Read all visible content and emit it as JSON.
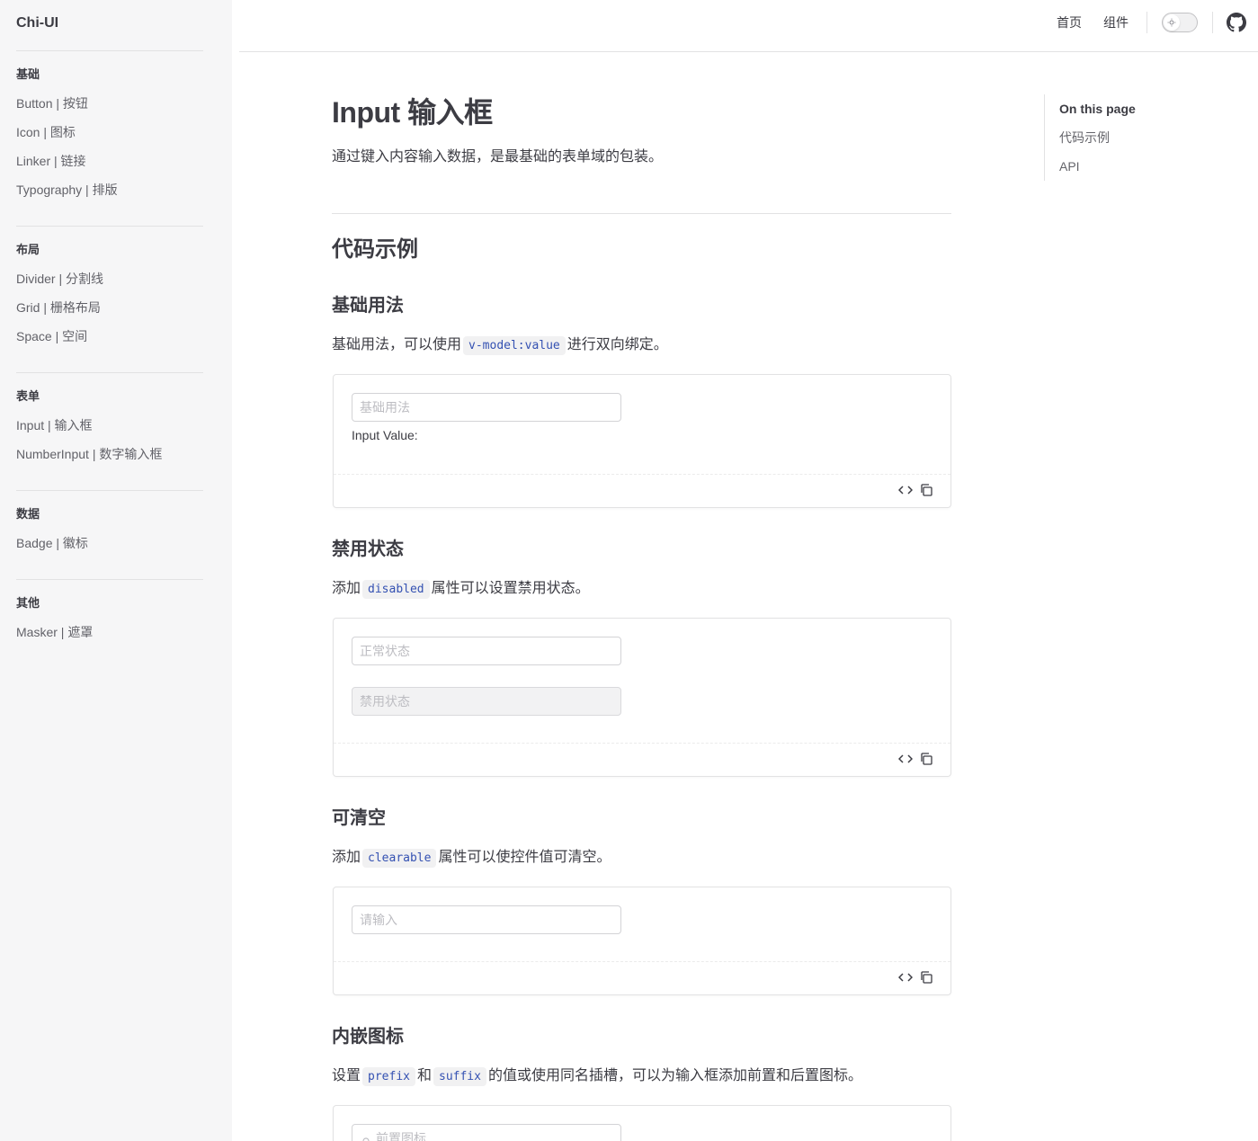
{
  "brand": "Chi-UI",
  "sidebar": {
    "groups": [
      {
        "title": "基础",
        "items": [
          "Button | 按钮",
          "Icon | 图标",
          "Linker | 链接",
          "Typography | 排版"
        ]
      },
      {
        "title": "布局",
        "items": [
          "Divider | 分割线",
          "Grid | 栅格布局",
          "Space | 空间"
        ]
      },
      {
        "title": "表单",
        "items": [
          "Input | 输入框",
          "NumberInput | 数字输入框"
        ]
      },
      {
        "title": "数据",
        "items": [
          "Badge | 徽标"
        ]
      },
      {
        "title": "其他",
        "items": [
          "Masker | 遮罩"
        ]
      }
    ]
  },
  "nav": {
    "home": "首页",
    "components": "组件",
    "theme_icon": "sun-icon",
    "github_icon": "github-icon"
  },
  "page": {
    "title": "Input 输入框",
    "lead": "通过键入内容输入数据，是最基础的表单域的包装。",
    "section_title": "代码示例"
  },
  "demos": {
    "basic": {
      "title": "基础用法",
      "text_before": "基础用法，可以使用",
      "code": "v-model:value",
      "text_after": "进行双向绑定。",
      "placeholder": "基础用法",
      "value_label": "Input Value:"
    },
    "disabled": {
      "title": "禁用状态",
      "text_before": "添加",
      "code": "disabled",
      "text_after": "属性可以设置禁用状态。",
      "placeholder_normal": "正常状态",
      "placeholder_disabled": "禁用状态"
    },
    "clearable": {
      "title": "可清空",
      "text_before": "添加",
      "code": "clearable",
      "text_after": "属性可以使控件值可清空。",
      "placeholder": "请输入"
    },
    "icons": {
      "title": "内嵌图标",
      "text_before": "设置",
      "code1": "prefix",
      "text_mid": "和",
      "code2": "suffix",
      "text_after": "的值或使用同名插槽，可以为输入框添加前置和后置图标。",
      "placeholder": "前置图标"
    }
  },
  "toc": {
    "title": "On this page",
    "items": [
      "代码示例",
      "API"
    ]
  }
}
